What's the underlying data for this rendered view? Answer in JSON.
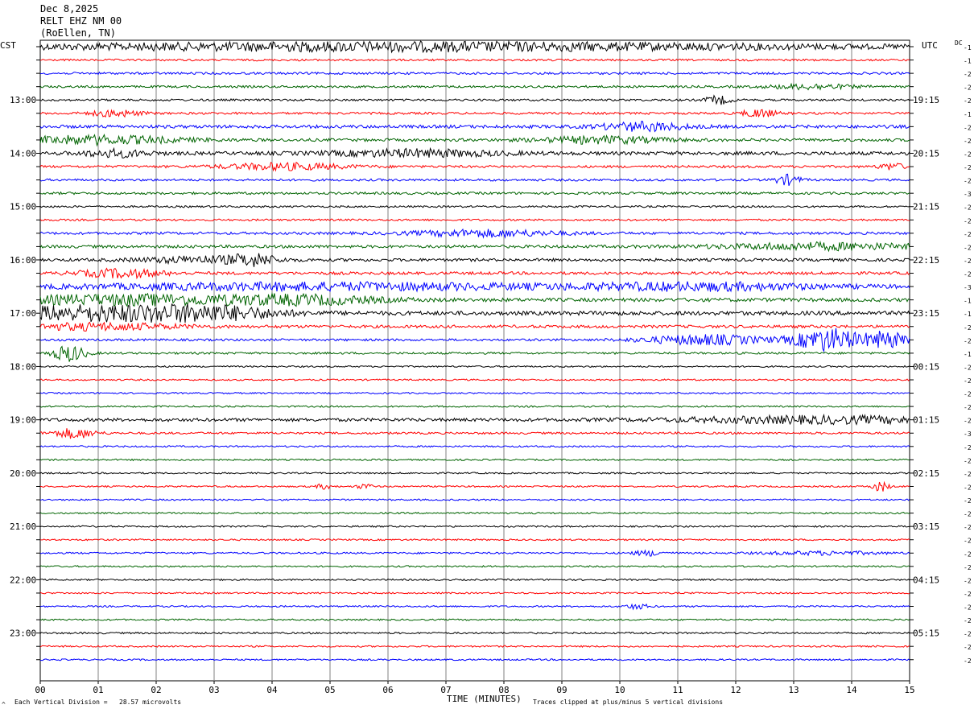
{
  "header": {
    "date": "Dec 8,2025",
    "station": "RELT EHZ NM 00",
    "location": "(RoEllen, TN)"
  },
  "labels": {
    "left_tz": "CST",
    "right_tz": "UTC",
    "dc": "DC",
    "xlabel": "TIME (MINUTES)",
    "footer_left": "Each Vertical Division =   28.57 microvolts",
    "footer_right": "Traces clipped at plus/minus 5 vertical divisions",
    "corner_mark": "^"
  },
  "colors": {
    "trace_cycle": [
      "#000000",
      "#ff0000",
      "#0000ff",
      "#006400"
    ],
    "grid": "#808080"
  },
  "chart_data": {
    "type": "line",
    "title": "RELT EHZ NM 00",
    "xlabel": "TIME (MINUTES)",
    "xlim": [
      0,
      15
    ],
    "x_ticks": [
      "00",
      "01",
      "02",
      "03",
      "04",
      "05",
      "06",
      "07",
      "08",
      "09",
      "10",
      "11",
      "12",
      "13",
      "14",
      "15"
    ],
    "traces_per_hour": 4,
    "left_hour_labels": [
      "13:00",
      "14:00",
      "15:00",
      "16:00",
      "17:00",
      "18:00",
      "19:00",
      "20:00",
      "21:00",
      "22:00",
      "23:00"
    ],
    "right_hour_labels": [
      "19:15",
      "20:15",
      "21:15",
      "22:15",
      "23:15",
      "00:15",
      "01:15",
      "02:15",
      "03:15",
      "04:15",
      "05:15"
    ],
    "dc_offsets": [
      -1,
      -1,
      -2,
      -2,
      -2,
      -1,
      -2,
      -2,
      -2,
      -2,
      -2,
      -3,
      -2,
      -2,
      -2,
      -2,
      -2,
      -2,
      -3,
      -1,
      -1,
      -2,
      -2,
      -1,
      -2,
      -2,
      -2,
      -2,
      -2,
      -3,
      -2,
      -2,
      -2,
      -2,
      -2,
      -2,
      -2,
      -2,
      -2,
      -2,
      -2,
      -2,
      -2,
      -2,
      -2,
      -2,
      -2
    ],
    "series": [
      {
        "amp": 2.0,
        "events": [
          [
            6.5,
            10,
            5
          ]
        ]
      },
      {
        "amp": 1.2,
        "events": []
      },
      {
        "amp": 1.4,
        "events": []
      },
      {
        "amp": 1.4,
        "events": [
          [
            13.3,
            1.0,
            3
          ]
        ]
      },
      {
        "amp": 1.3,
        "events": [
          [
            11.7,
            0.3,
            5
          ]
        ]
      },
      {
        "amp": 1.4,
        "events": [
          [
            1.3,
            0.6,
            4
          ],
          [
            12.4,
            0.4,
            5
          ]
        ]
      },
      {
        "amp": 2.0,
        "events": [
          [
            10.4,
            1.0,
            5
          ]
        ]
      },
      {
        "amp": 1.8,
        "events": [
          [
            1.0,
            2.0,
            5
          ],
          [
            9.7,
            1.5,
            4
          ]
        ]
      },
      {
        "amp": 2.2,
        "events": [
          [
            1.3,
            0.8,
            4
          ],
          [
            6.5,
            2.0,
            4
          ]
        ]
      },
      {
        "amp": 1.5,
        "events": [
          [
            4.2,
            1.5,
            4
          ],
          [
            14.7,
            0.3,
            4
          ]
        ]
      },
      {
        "amp": 1.4,
        "events": [
          [
            12.9,
            0.3,
            6
          ]
        ]
      },
      {
        "amp": 1.5,
        "events": []
      },
      {
        "amp": 1.2,
        "events": []
      },
      {
        "amp": 1.2,
        "events": []
      },
      {
        "amp": 1.6,
        "events": [
          [
            7.7,
            1.8,
            4
          ]
        ]
      },
      {
        "amp": 1.8,
        "events": [
          [
            13.5,
            2.5,
            4
          ]
        ]
      },
      {
        "amp": 1.8,
        "events": [
          [
            2.8,
            1.5,
            4
          ],
          [
            3.7,
            0.5,
            6
          ]
        ]
      },
      {
        "amp": 1.8,
        "events": [
          [
            1.4,
            1.0,
            5
          ]
        ]
      },
      {
        "amp": 2.2,
        "events": [
          [
            5.0,
            6.0,
            4
          ],
          [
            11.5,
            3.0,
            4
          ]
        ]
      },
      {
        "amp": 2.2,
        "events": [
          [
            1.5,
            3.0,
            6
          ],
          [
            4.5,
            2.0,
            5
          ]
        ]
      },
      {
        "amp": 2.5,
        "events": [
          [
            1.0,
            3.0,
            9
          ],
          [
            3.0,
            1.5,
            6
          ]
        ]
      },
      {
        "amp": 1.8,
        "events": [
          [
            1.0,
            2.0,
            4
          ]
        ]
      },
      {
        "amp": 1.4,
        "events": [
          [
            11.5,
            1.5,
            6
          ],
          [
            13.6,
            0.8,
            14
          ],
          [
            14.6,
            0.5,
            10
          ]
        ]
      },
      {
        "amp": 1.3,
        "events": [
          [
            0.5,
            0.4,
            10
          ]
        ]
      },
      {
        "amp": 1.0,
        "events": []
      },
      {
        "amp": 1.0,
        "events": []
      },
      {
        "amp": 1.0,
        "events": []
      },
      {
        "amp": 1.0,
        "events": []
      },
      {
        "amp": 2.0,
        "events": [
          [
            13.5,
            3.5,
            4
          ]
        ]
      },
      {
        "amp": 1.3,
        "events": [
          [
            0.6,
            0.5,
            6
          ]
        ]
      },
      {
        "amp": 1.0,
        "events": []
      },
      {
        "amp": 1.0,
        "events": []
      },
      {
        "amp": 1.0,
        "events": []
      },
      {
        "amp": 1.0,
        "events": [
          [
            14.5,
            0.2,
            6
          ],
          [
            4.9,
            0.2,
            3
          ],
          [
            5.6,
            0.2,
            3
          ]
        ]
      },
      {
        "amp": 1.0,
        "events": []
      },
      {
        "amp": 1.0,
        "events": []
      },
      {
        "amp": 1.0,
        "events": []
      },
      {
        "amp": 1.0,
        "events": []
      },
      {
        "amp": 1.1,
        "events": [
          [
            10.5,
            0.4,
            3
          ],
          [
            13.5,
            1.5,
            2
          ]
        ]
      },
      {
        "amp": 1.0,
        "events": []
      },
      {
        "amp": 1.0,
        "events": []
      },
      {
        "amp": 1.0,
        "events": []
      },
      {
        "amp": 1.0,
        "events": [
          [
            10.3,
            0.3,
            3
          ]
        ]
      },
      {
        "amp": 1.0,
        "events": []
      },
      {
        "amp": 1.1,
        "events": []
      },
      {
        "amp": 1.0,
        "events": []
      },
      {
        "amp": 1.0,
        "events": []
      }
    ]
  }
}
